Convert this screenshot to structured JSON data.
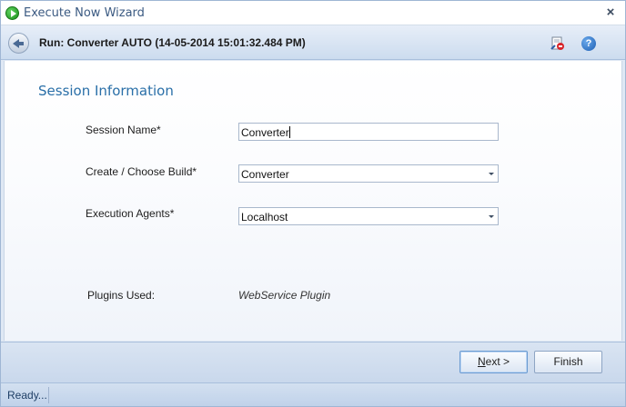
{
  "window": {
    "title": "Execute Now Wizard",
    "close_glyph": "×"
  },
  "header": {
    "run_title": "Run: Converter AUTO (14-05-2014 15:01:32.484 PM)",
    "help_glyph": "?"
  },
  "section": {
    "title": "Session Information"
  },
  "form": {
    "session_name_label": "Session Name*",
    "session_name_value": "Converter",
    "build_label": "Create / Choose Build*",
    "build_value": "Converter",
    "agents_label": "Execution Agents*",
    "agents_value": "Localhost",
    "plugins_label": "Plugins Used:",
    "plugins_value": "WebService Plugin"
  },
  "buttons": {
    "next_mnemonic": "N",
    "next_rest": "ext >",
    "finish_label": "Finish"
  },
  "status": {
    "text": "Ready..."
  },
  "icons": {
    "title": "play-icon",
    "back": "back-arrow-icon",
    "report": "report-icon",
    "help": "help-icon",
    "close": "close-icon",
    "dropdown": "chevron-down-icon"
  }
}
